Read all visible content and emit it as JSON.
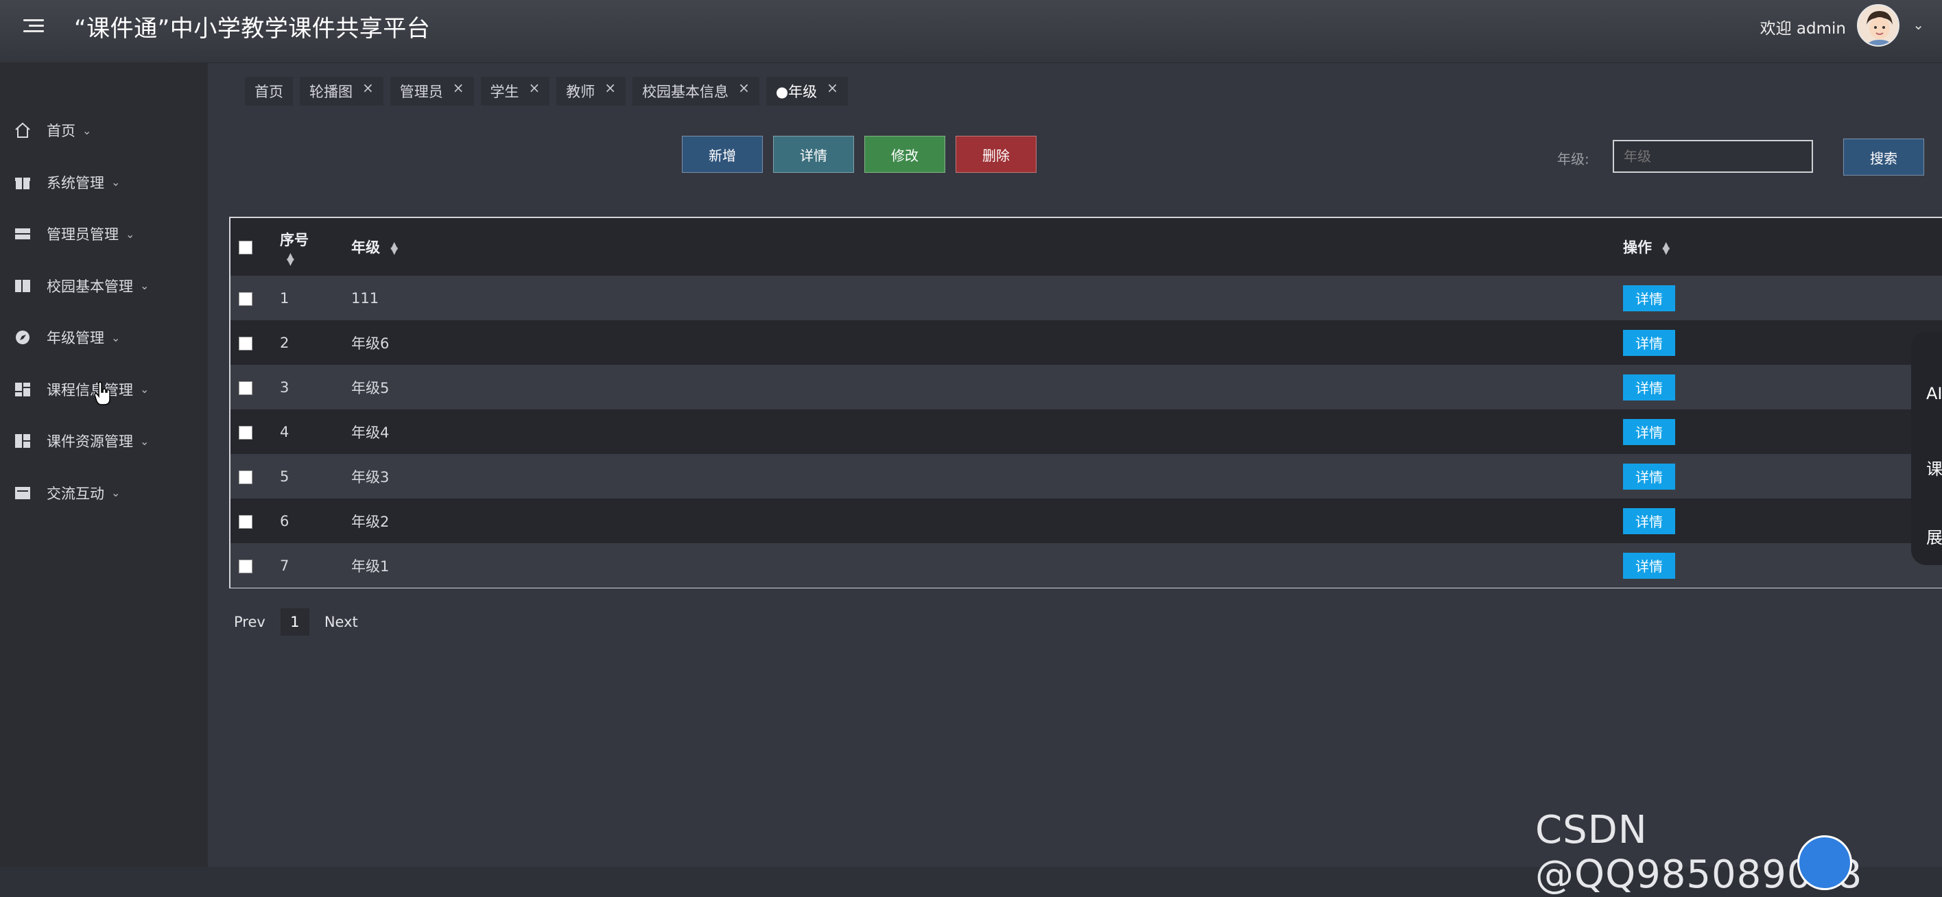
{
  "header": {
    "title": "“课件通”中小学教学课件共享平台",
    "welcome": "欢迎 admin"
  },
  "sidebar": {
    "items": [
      {
        "label": "首页",
        "icon": "home-icon"
      },
      {
        "label": "系统管理",
        "icon": "gift-icon"
      },
      {
        "label": "管理员管理",
        "icon": "server-icon"
      },
      {
        "label": "校园基本管理",
        "icon": "columns-icon"
      },
      {
        "label": "年级管理",
        "icon": "compass-icon"
      },
      {
        "label": "课程信息管理",
        "icon": "dashboard-icon"
      },
      {
        "label": "课件资源管理",
        "icon": "grid-icon"
      },
      {
        "label": "交流互动",
        "icon": "message-icon"
      }
    ]
  },
  "tabs": [
    {
      "label": "首页",
      "closable": false
    },
    {
      "label": "轮播图",
      "closable": true
    },
    {
      "label": "管理员",
      "closable": true
    },
    {
      "label": "学生",
      "closable": true
    },
    {
      "label": "教师",
      "closable": true
    },
    {
      "label": "校园基本信息",
      "closable": true
    },
    {
      "label": "●年级",
      "closable": true
    }
  ],
  "close_glyph": "×",
  "toolbar": {
    "add": "新增",
    "detail": "详情",
    "edit": "修改",
    "delete": "删除",
    "search_label": "年级:",
    "search_placeholder": "年级",
    "search_button": "搜索"
  },
  "table": {
    "headers": {
      "index": "序号",
      "grade": "年级",
      "action": "操作"
    },
    "rows": [
      {
        "index": "1",
        "grade": "111"
      },
      {
        "index": "2",
        "grade": "年级6"
      },
      {
        "index": "3",
        "grade": "年级5"
      },
      {
        "index": "4",
        "grade": "年级4"
      },
      {
        "index": "5",
        "grade": "年级3"
      },
      {
        "index": "6",
        "grade": "年级2"
      },
      {
        "index": "7",
        "grade": "年级1"
      }
    ],
    "row_action": "详情"
  },
  "pagination": {
    "prev": "Prev",
    "page": "1",
    "next": "Next"
  },
  "float_panel": {
    "items": [
      "AI",
      "课",
      "展"
    ]
  },
  "watermark": "CSDN @QQ985089028",
  "colors": {
    "topbar": "#3a3d45",
    "sidebar": "#2b2d33",
    "add": "#30557b",
    "detail": "#3c6f7d",
    "edit": "#3f8a4b",
    "delete": "#9d3135",
    "chip": "#12a1e8"
  }
}
